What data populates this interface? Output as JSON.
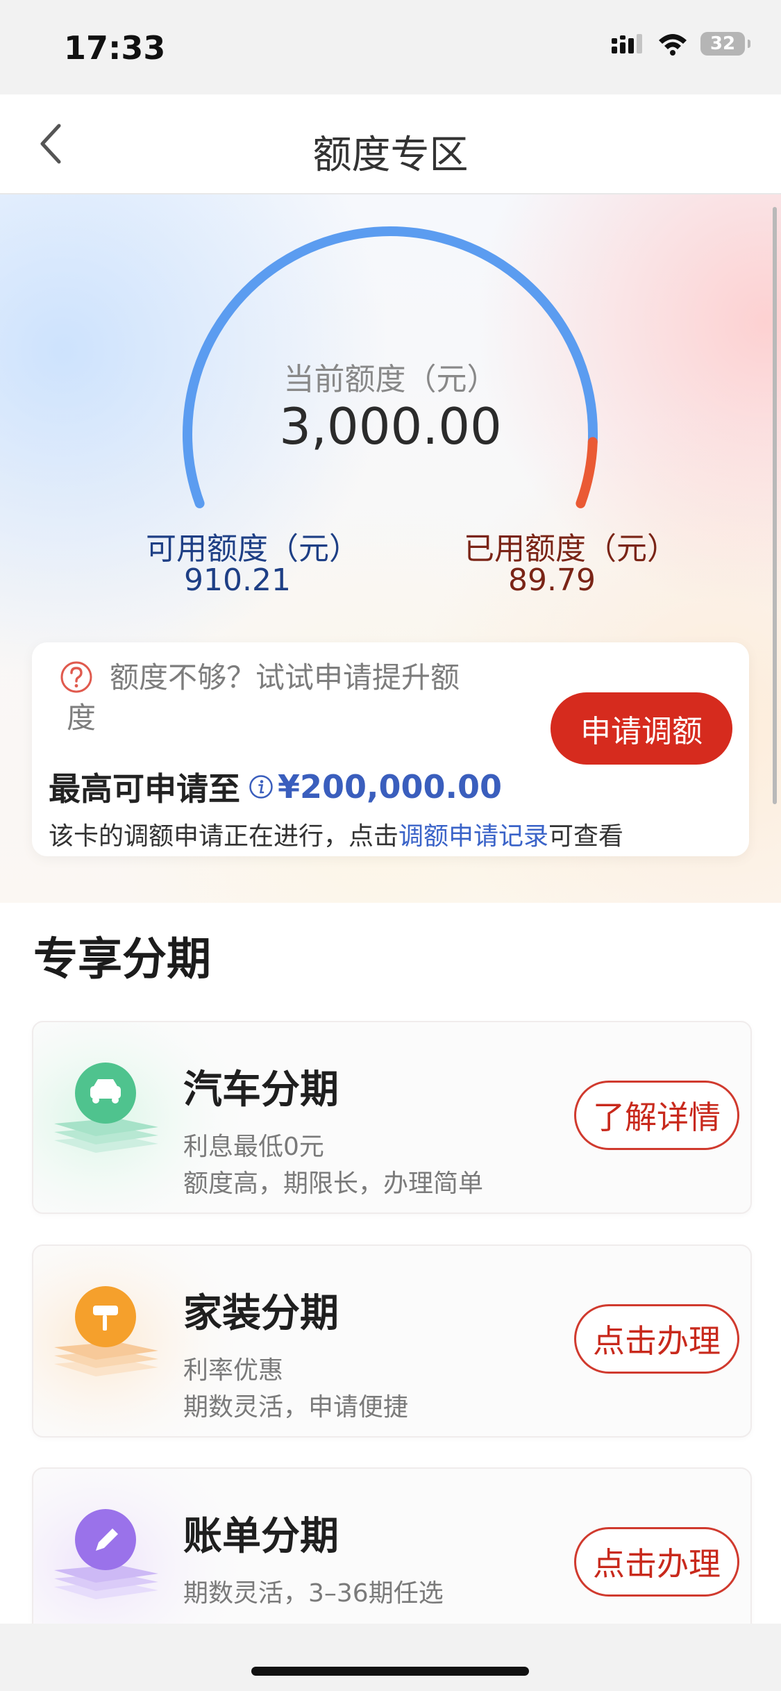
{
  "status_bar": {
    "time": "17:33",
    "battery": "32"
  },
  "nav": {
    "title": "额度专区"
  },
  "credit": {
    "current_label": "当前额度（元）",
    "current_value": "3,000.00",
    "available_label": "可用额度（元）",
    "available_value": "910.21",
    "used_label": "已用额度（元）",
    "used_value": "89.79",
    "used_fraction": 0.0299
  },
  "increase_card": {
    "prompt": "额度不够？试试申请提升额度",
    "max_label": "最高可申请至",
    "max_value": "¥200,000.00",
    "apply_button": "申请调额",
    "note_prefix": "该卡的调额申请正在进行，点击",
    "note_link": "调额申请记录",
    "note_suffix": "可查看"
  },
  "section": {
    "title": "专享分期"
  },
  "products": [
    {
      "name": "汽车分期",
      "desc1": "利息最低0元",
      "desc2": "额度高，期限长，办理简单",
      "button": "了解详情",
      "icon": "car-icon"
    },
    {
      "name": "家装分期",
      "desc1": "利率优惠",
      "desc2": "期数灵活，申请便捷",
      "button": "点击办理",
      "icon": "paint-roller-icon"
    },
    {
      "name": "账单分期",
      "desc1": "期数灵活，3–36期任选",
      "desc2": "",
      "button": "点击办理",
      "icon": "pencil-icon"
    }
  ],
  "colors": {
    "gauge_available": "#5b9cf0",
    "gauge_used": "#ea5a34",
    "accent_red": "#d62b1e",
    "link_blue": "#3a63c8"
  }
}
